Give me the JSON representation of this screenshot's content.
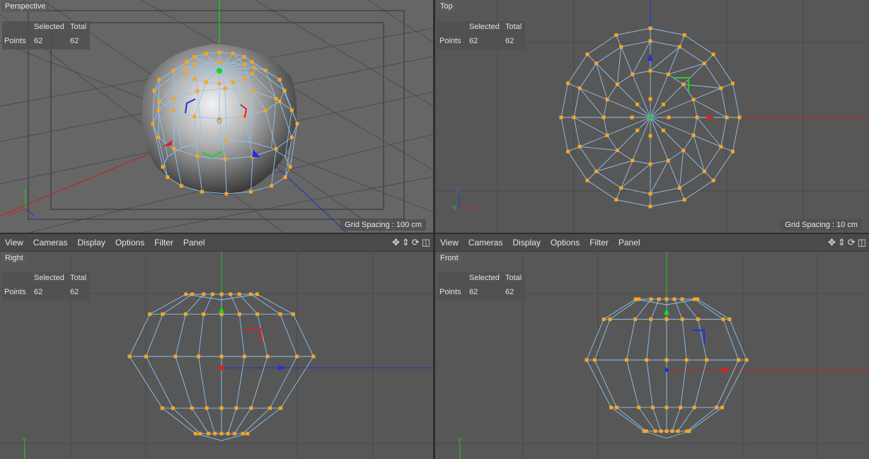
{
  "viewports": {
    "perspective": {
      "name": "Perspective",
      "grid_spacing": "Grid Spacing : 100 cm"
    },
    "top": {
      "name": "Top",
      "grid_spacing": "Grid Spacing : 10 cm"
    },
    "right": {
      "name": "Right"
    },
    "front": {
      "name": "Front"
    }
  },
  "hud": {
    "selected_label": "Selected",
    "total_label": "Total",
    "points_label": "Points",
    "selected_value": "62",
    "total_value": "62"
  },
  "menu": {
    "view": "View",
    "cameras": "Cameras",
    "display": "Display",
    "options": "Options",
    "filter": "Filter",
    "panel": "Panel"
  },
  "axes": {
    "x": "X",
    "y": "Y",
    "z": "Z"
  },
  "icons": {
    "move": "move-view-icon",
    "pan": "pan-view-icon",
    "rotate": "rotate-view-icon",
    "maximize": "toggle-layout-icon"
  },
  "colors": {
    "point": "#f5a623",
    "edge": "#8fc3f0",
    "x_axis": "#e02020",
    "y_axis": "#20d020",
    "z_axis": "#2030e0"
  }
}
